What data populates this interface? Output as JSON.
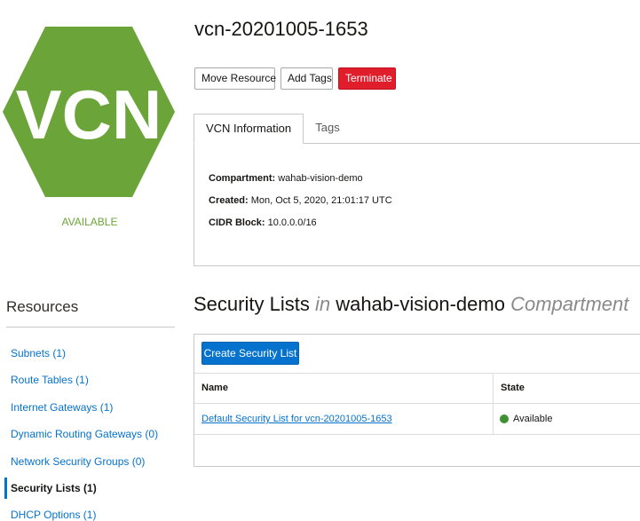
{
  "vcn_icon": {
    "text": "VCN",
    "color": "#6ba539"
  },
  "vcn_status": "AVAILABLE",
  "page_title": "vcn-20201005-1653",
  "actions": {
    "move_resource": "Move Resource",
    "add_tags": "Add Tags",
    "terminate": "Terminate"
  },
  "tabs": {
    "vcn_information": "VCN Information",
    "tags": "Tags"
  },
  "info": {
    "compartment_label": "Compartment:",
    "compartment_value": "wahab-vision-demo",
    "created_label": "Created:",
    "created_value": "Mon, Oct 5, 2020, 21:01:17 UTC",
    "cidr_label": "CIDR Block:",
    "cidr_value": "10.0.0.0/16"
  },
  "resources": {
    "title": "Resources",
    "items": [
      {
        "label": "Subnets (1)"
      },
      {
        "label": "Route Tables (1)"
      },
      {
        "label": "Internet Gateways (1)"
      },
      {
        "label": "Dynamic Routing Gateways (0)"
      },
      {
        "label": "Network Security Groups (0)"
      },
      {
        "label": "Security Lists (1)",
        "active": true
      },
      {
        "label": "DHCP Options (1)"
      }
    ]
  },
  "section": {
    "title_main": "Security Lists",
    "title_in": "in",
    "title_compartment": "wahab-vision-demo",
    "title_suffix": "Compartment"
  },
  "table": {
    "create_button": "Create Security List",
    "headers": {
      "name": "Name",
      "state": "State"
    },
    "rows": [
      {
        "name": "Default Security List for vcn-20201005-1653",
        "state": "Available",
        "state_color": "#3f8f33"
      }
    ]
  }
}
